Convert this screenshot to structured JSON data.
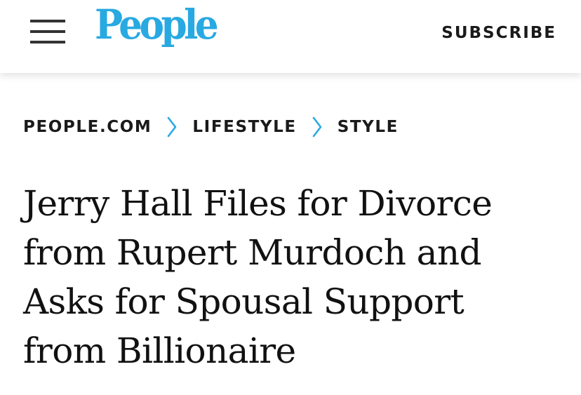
{
  "header": {
    "logo_text": "People",
    "subscribe_label": "SUBSCRIBE",
    "menu_icon": "hamburger-menu-icon",
    "brand_color": "#29a9e1"
  },
  "breadcrumb": {
    "items": [
      {
        "label": "PEOPLE.COM"
      },
      {
        "label": "LIFESTYLE"
      },
      {
        "label": "STYLE"
      }
    ],
    "separator_icon": "chevron-right-icon",
    "separator_color": "#29a9e1"
  },
  "article": {
    "headline_lines": [
      "Jerry Hall Files for Divorce",
      "from Rupert Murdoch and",
      "Asks for Spousal Support",
      "from Billionaire"
    ]
  }
}
